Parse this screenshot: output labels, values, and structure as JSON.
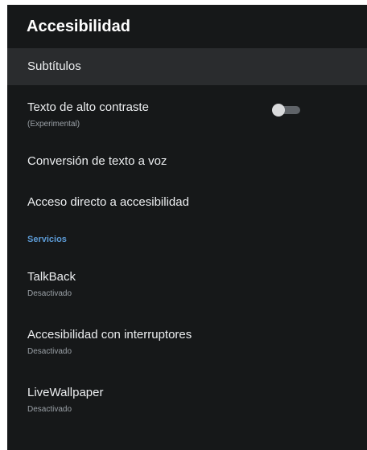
{
  "header": {
    "title": "Accesibilidad"
  },
  "items": [
    {
      "label": "Subtítulos"
    },
    {
      "label": "Texto de alto contraste",
      "sub": "(Experimental)",
      "toggle_on": false
    },
    {
      "label": "Conversión de texto a voz"
    },
    {
      "label": "Acceso directo a accesibilidad"
    }
  ],
  "section": {
    "title": "Servicios"
  },
  "services": [
    {
      "label": "TalkBack",
      "status": "Desactivado"
    },
    {
      "label": "Accesibilidad con interruptores",
      "status": "Desactivado"
    },
    {
      "label": "LiveWallpaper",
      "status": "Desactivado"
    }
  ],
  "colors": {
    "background": "#161819",
    "focused_row": "#2a2c2e",
    "section_accent": "#5c9bd6"
  }
}
